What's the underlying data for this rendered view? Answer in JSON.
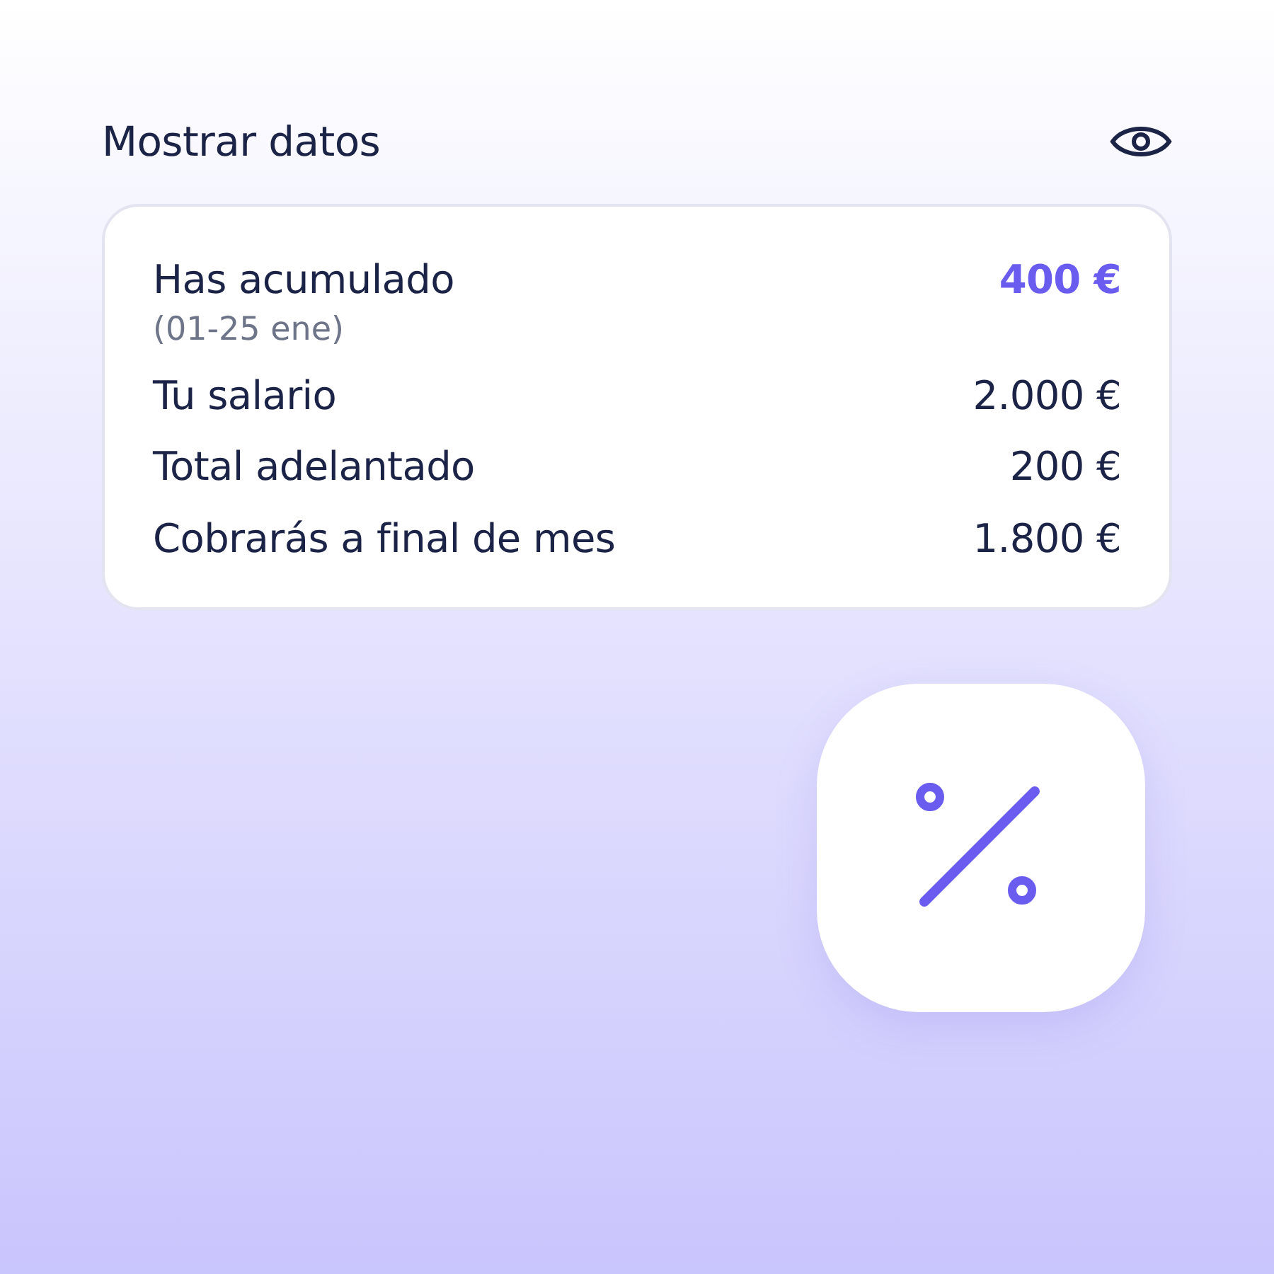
{
  "header": {
    "title": "Mostrar datos"
  },
  "summary": [
    {
      "kind": "highlight",
      "label": "Has acumulado",
      "subtitle": "(01-25 ene)",
      "amount": "400 €"
    },
    {
      "kind": "plain",
      "label": "Tu salario",
      "amount": "2.000 €"
    },
    {
      "kind": "plain",
      "label": "Total adelantado",
      "amount": "200 €"
    },
    {
      "kind": "plain",
      "label": "Cobrarás a final de mes",
      "amount": "1.800 €"
    }
  ]
}
